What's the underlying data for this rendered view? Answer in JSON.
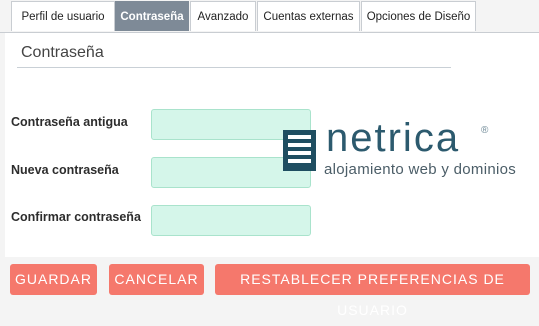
{
  "tabs": [
    {
      "label": "Perfil de usuario",
      "active": false
    },
    {
      "label": "Contraseña",
      "active": true
    },
    {
      "label": "Avanzado",
      "active": false
    },
    {
      "label": "Cuentas externas",
      "active": false
    },
    {
      "label": "Opciones de Diseño",
      "active": false
    }
  ],
  "section": {
    "title": "Contraseña"
  },
  "fields": {
    "old_password": {
      "label": "Contraseña antigua",
      "value": ""
    },
    "new_password": {
      "label": "Nueva contraseña",
      "value": ""
    },
    "confirm_password": {
      "label": "Confirmar contraseña",
      "value": ""
    }
  },
  "watermark": {
    "brand": "netrica",
    "registered": "®",
    "tagline": "alojamiento web y dominios",
    "icon": "hamburger-icon"
  },
  "buttons": {
    "save": "GUARDAR",
    "cancel": "CANCELAR",
    "reset": "RESTABLECER PREFERENCIAS DE USUARIO"
  },
  "colors": {
    "active_tab": "#7e8a97",
    "input_bg": "#d5f6ea",
    "button_bg": "#f5786c",
    "logo": "#1f4e61"
  }
}
